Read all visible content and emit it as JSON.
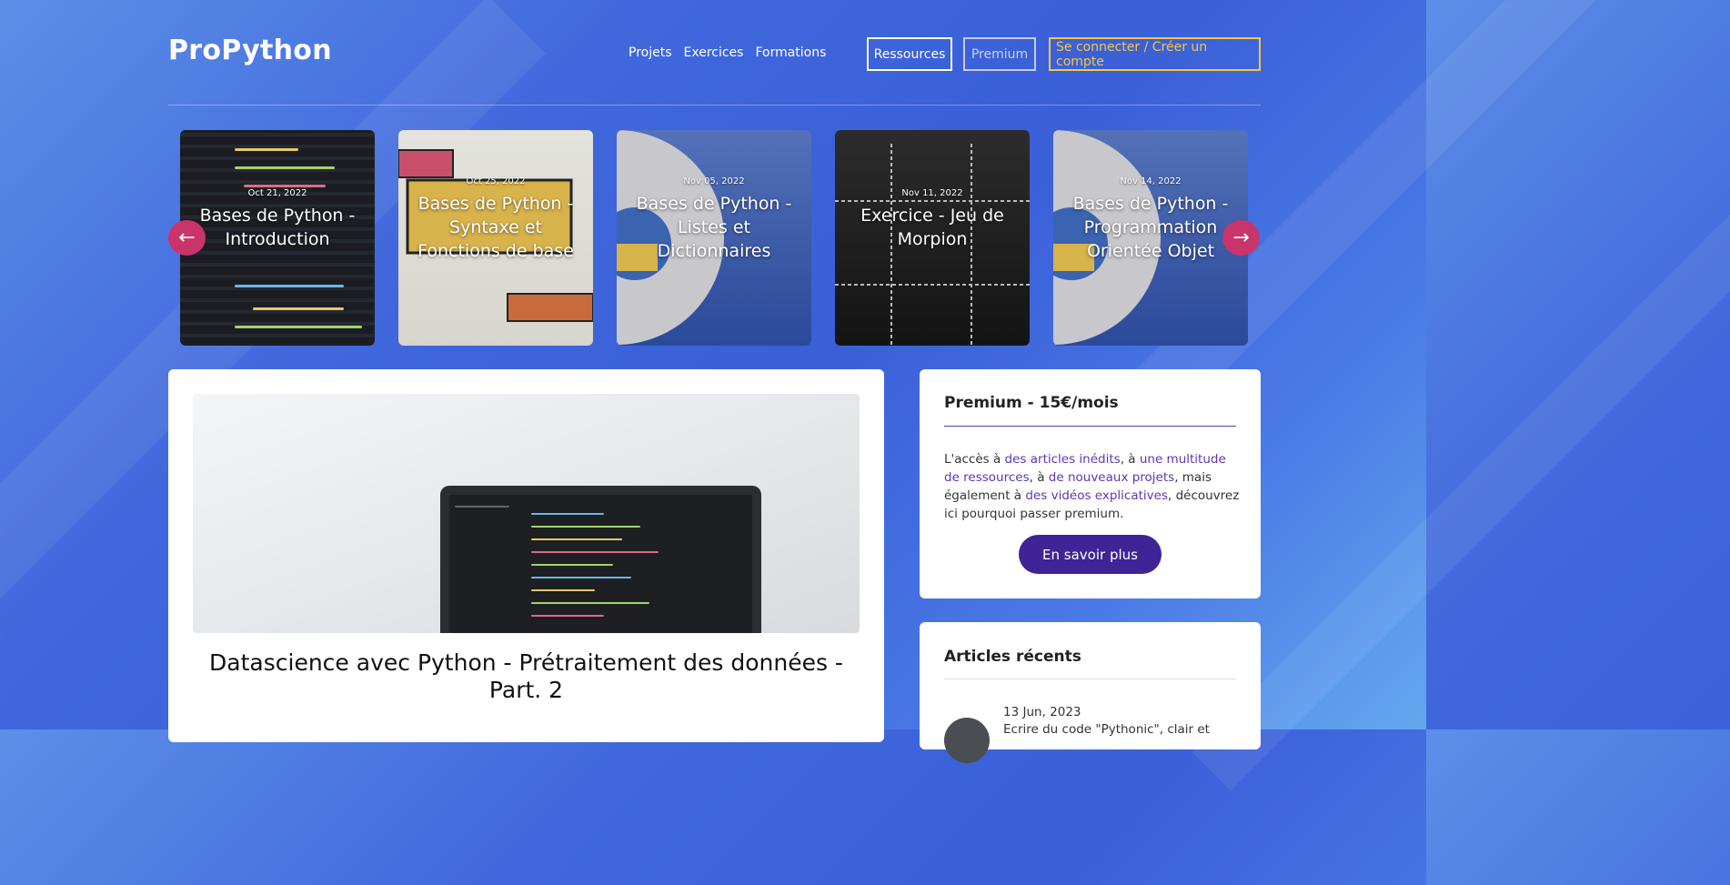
{
  "header": {
    "logo": "ProPython",
    "nav": [
      "Projets",
      "Exercices",
      "Formations"
    ],
    "resources_button": "Ressources",
    "premium_button": "Premium",
    "login_button": "Se connecter / Créer un compte"
  },
  "carousel": {
    "cards": [
      {
        "date": "Oct 21, 2022",
        "title": "Bases de Python - Introduction"
      },
      {
        "date": "Oct 25, 2022",
        "title": "Bases de Python - Syntaxe et Fonctions de base"
      },
      {
        "date": "Nov 05, 2022",
        "title": "Bases de Python - Listes et Dictionnaires"
      },
      {
        "date": "Nov 11, 2022",
        "title": "Exercice - Jeu de Morpion"
      },
      {
        "date": "Nov 14, 2022",
        "title": "Bases de Python - Programmation Orientée Objet"
      }
    ],
    "prev_icon": "arrow-left-icon",
    "next_icon": "arrow-right-icon"
  },
  "main": {
    "article_title": "Datascience avec Python - Prétraitement des données - Part. 2"
  },
  "premium_box": {
    "title": "Premium - 15€/mois",
    "text_1": "L'accès à ",
    "link_1": "des articles inédits",
    "text_2": ", à ",
    "link_2": "une multitude de ressources",
    "text_3": ", à ",
    "link_3": "de nouveaux projets",
    "text_4": ", mais également à ",
    "link_4": "des vidéos explicatives",
    "text_5": ", découvrez ici pourquoi passer premium.",
    "button": "En savoir plus"
  },
  "recent": {
    "title": "Articles récents",
    "items": [
      {
        "date": "13 Jun, 2023",
        "title": "Ecrire du code \"Pythonic\", clair et"
      }
    ]
  },
  "colors": {
    "accent_pink": "#c8356a",
    "premium_purple": "#3f2496",
    "login_yellow": "#f5c842"
  }
}
